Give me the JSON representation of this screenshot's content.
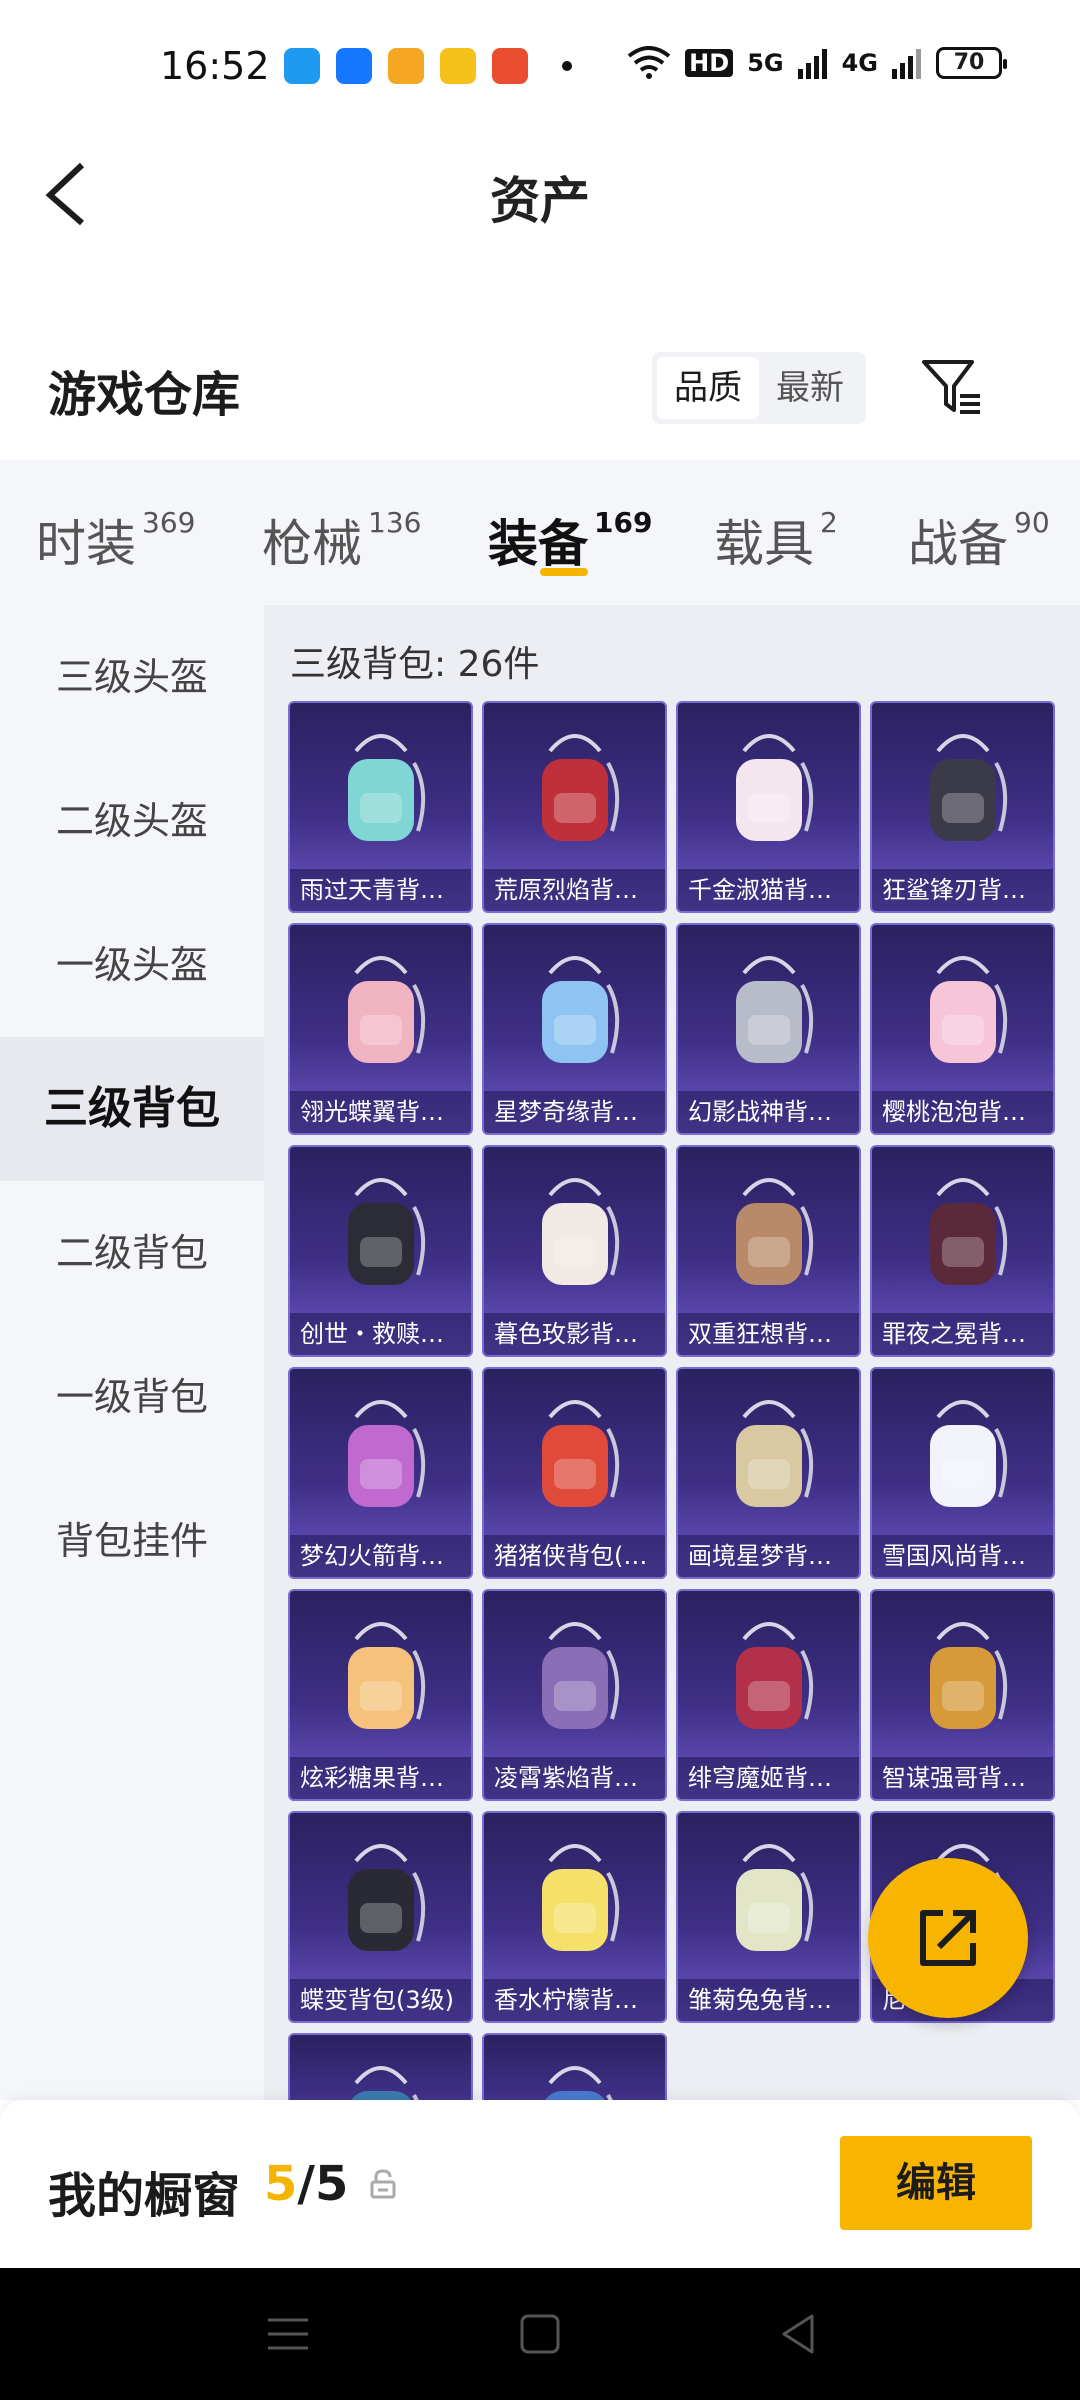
{
  "status": {
    "time": "16:52",
    "battery": "70",
    "net_labels": [
      "HD",
      "5G",
      "4G"
    ],
    "app_colors": [
      "#1e9bf0",
      "#1677ff",
      "#f5a623",
      "#f7c11c",
      "#e94f2f"
    ]
  },
  "header": {
    "title": "资产"
  },
  "warehouse": {
    "title": "游戏仓库",
    "sort": [
      "品质",
      "最新"
    ],
    "sort_active": "品质"
  },
  "categories": [
    {
      "label": "时装",
      "count": "369"
    },
    {
      "label": "枪械",
      "count": "136"
    },
    {
      "label": "装备",
      "count": "169"
    },
    {
      "label": "载具",
      "count": "2"
    },
    {
      "label": "战备",
      "count": "90"
    }
  ],
  "sidebar": {
    "items": [
      {
        "label": "三级头盔"
      },
      {
        "label": "二级头盔"
      },
      {
        "label": "一级头盔"
      },
      {
        "label": "三级背包"
      },
      {
        "label": "二级背包"
      },
      {
        "label": "一级背包"
      },
      {
        "label": "背包挂件"
      }
    ],
    "active": "三级背包"
  },
  "content": {
    "count_label": "三级背包: 26件",
    "items": [
      {
        "name": "雨过天青背包...",
        "color": "#7fd6d4",
        "icon": "backpack-icon"
      },
      {
        "name": "荒原烈焰背包...",
        "color": "#c0303a",
        "icon": "backpack-icon"
      },
      {
        "name": "千金淑猫背包...",
        "color": "#f3e6ee",
        "icon": "backpack-icon"
      },
      {
        "name": "狂鲨锋刃背包...",
        "color": "#3b3a48",
        "icon": "backpack-icon"
      },
      {
        "name": "翎光蝶翼背包...",
        "color": "#f0b3c2",
        "icon": "backpack-icon"
      },
      {
        "name": "星梦奇缘背包...",
        "color": "#8fc4f2",
        "icon": "backpack-icon"
      },
      {
        "name": "幻影战神背包...",
        "color": "#b8bcc8",
        "icon": "backpack-icon"
      },
      {
        "name": "樱桃泡泡背包...",
        "color": "#f6c6d8",
        "icon": "backpack-icon"
      },
      {
        "name": "创世・救赎背...",
        "color": "#2c2c36",
        "icon": "backpack-icon"
      },
      {
        "name": "暮色玫影背包...",
        "color": "#f1e9e3",
        "icon": "backpack-icon"
      },
      {
        "name": "双重狂想背包...",
        "color": "#b98a6a",
        "icon": "backpack-icon"
      },
      {
        "name": "罪夜之冕背包...",
        "color": "#5a2a3a",
        "icon": "backpack-icon"
      },
      {
        "name": "梦幻火箭背包...",
        "color": "#c06ad0",
        "icon": "backpack-icon"
      },
      {
        "name": "猪猪侠背包(3...",
        "color": "#e04a3a",
        "icon": "backpack-icon"
      },
      {
        "name": "画境星梦背包...",
        "color": "#d8c9a0",
        "icon": "backpack-icon"
      },
      {
        "name": "雪国风尚背包...",
        "color": "#f2f2fb",
        "icon": "backpack-icon"
      },
      {
        "name": "炫彩糖果背包...",
        "color": "#f4c27a",
        "icon": "backpack-icon"
      },
      {
        "name": "凌霄紫焰背包...",
        "color": "#8a6fb6",
        "icon": "backpack-icon"
      },
      {
        "name": "绯穹魔姬背包...",
        "color": "#b3304a",
        "icon": "backpack-icon"
      },
      {
        "name": "智谋强哥背包...",
        "color": "#d69a3a",
        "icon": "backpack-icon"
      },
      {
        "name": "蝶变背包(3级)",
        "color": "#2a2a34",
        "icon": "backpack-icon"
      },
      {
        "name": "香水柠檬背包...",
        "color": "#f5e06a",
        "icon": "backpack-icon"
      },
      {
        "name": "雏菊兔兔背包...",
        "color": "#e2e6c6",
        "icon": "backpack-icon"
      },
      {
        "name": "尼...背...",
        "color": "#c9a34a",
        "icon": "backpack-icon"
      },
      {
        "name": "",
        "color": "#3a7ab0",
        "icon": "backpack-icon"
      },
      {
        "name": "",
        "color": "#4a7ad0",
        "icon": "backpack-icon"
      }
    ]
  },
  "showcase": {
    "label": "我的橱窗",
    "current": "5",
    "separator": "/",
    "total": "5",
    "edit_label": "编辑"
  },
  "colors": {
    "accent": "#f5b400",
    "card_top": "#2a2160",
    "card_bottom": "#6e58c8"
  }
}
